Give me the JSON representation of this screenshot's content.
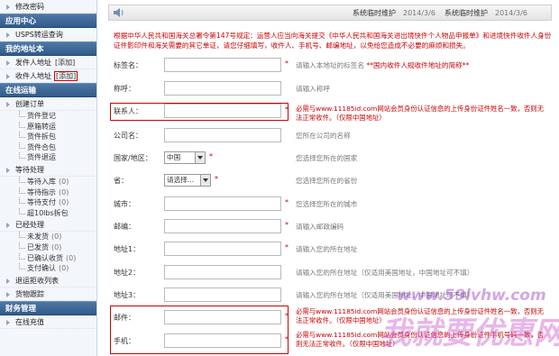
{
  "sidebar": {
    "top_item": "修改密码",
    "sections": [
      {
        "title": "应用中心",
        "items": [
          {
            "label": "USPS转运查询"
          }
        ]
      },
      {
        "title": "我的地址本",
        "items": [
          {
            "label": "发件人地址",
            "add": "[添加]"
          },
          {
            "label": "收件人地址",
            "add": "[添加]"
          }
        ]
      },
      {
        "title": "在线运输",
        "groups": [
          {
            "label": "创建订单",
            "subs": [
              {
                "label": "货件登记"
              },
              {
                "label": "原箱转运"
              },
              {
                "label": "货件拆包"
              },
              {
                "label": "货件合包"
              },
              {
                "label": "货件退运"
              }
            ]
          },
          {
            "label": "等待处理",
            "subs": [
              {
                "label": "等待入库",
                "count": "(0)"
              },
              {
                "label": "等待指示",
                "count": "(0)"
              },
              {
                "label": "等待支付",
                "count": "(0)"
              },
              {
                "label": "超10lbs拆包",
                "count": ""
              }
            ]
          },
          {
            "label": "已经处理",
            "subs": [
              {
                "label": "未发货",
                "count": "(0)"
              },
              {
                "label": "已发货",
                "count": "(0)"
              },
              {
                "label": "已确认收货",
                "count": "(0)"
              },
              {
                "label": "支付确认",
                "count": "(0)"
              }
            ]
          },
          {
            "label": "退运拒收列表",
            "subs": []
          },
          {
            "label": "货物跟踪",
            "subs": []
          }
        ]
      },
      {
        "title": "财务管理",
        "items": [
          {
            "label": "在线充值"
          }
        ]
      }
    ]
  },
  "topbar": {
    "notices": [
      {
        "text": "系统临时维护",
        "date": "2014/3/6"
      },
      {
        "text": "系统临时维护",
        "date": "2014/3/6"
      }
    ]
  },
  "warning": "根据中华人民共和国海关总署令第147号规定：运营人应当向海关提交《中华人民共和国海关进出境快件个人物品申报单》和进境快件收件人身份证件影印件和海关需要的其它单证，请您仔细填写，收件人、手机号、邮编地址，以免给您造成不必要的麻烦和损失。",
  "form": {
    "tag_label": "标签名：",
    "tag_hint": "请输入本地址的标签名",
    "tag_hint_red": "**国内收件人规收件地址的简称**",
    "nick_label": "称呼：",
    "nick_hint": "请输入称呼",
    "contact_label": "联系人：",
    "contact_hint": "必需与www.11185id.com网站会员身份认证信息的上传身份证件姓名一致，否则无法正常收件。（仅限中国地址）",
    "company_label": "公司名：",
    "company_hint": "您所在公司的名称",
    "country_label": "国家/地区：",
    "country_value": "中国",
    "country_hint": "您选择您所在的国家",
    "province_label": "省：",
    "province_value": "请选择...",
    "province_hint": "您选择您所在的省份",
    "city_label": "城市：",
    "city_hint": "您选择您所在的城市",
    "zip_label": "邮编：",
    "zip_hint": "请输入邮政编码",
    "addr1_label": "地址1：",
    "addr1_hint": "请输入您的所在地址",
    "addr2_label": "地址2：",
    "addr2_hint": "请输入您的所在地址（仅适用美国地址，中国地址可不填）",
    "addr3_label": "地址3：",
    "addr3_hint": "请输入您的所在地址（仅适用美国地址，中国地址可不填）",
    "mail_label": "邮件：",
    "mail_hint": "必需与www.11185id.com网站会员身份认证信息的上传身份证件姓名一致，否则无法正常收件。（仅限中国地址）",
    "phone_label": "手机：",
    "phone_hint": "必需与www.11185id.com网站会员身份认证信息的上传身份证件手机号码一致，否则无法正常收件。（仅限中国地址）",
    "required": "*"
  },
  "watermark": {
    "url": "www.59lvhw.com",
    "brand": "我就要优惠网"
  },
  "colors": {
    "sidebar_header": "#305b8b",
    "warning_red": "#cc0000",
    "highlight_box": "#cc0000"
  }
}
